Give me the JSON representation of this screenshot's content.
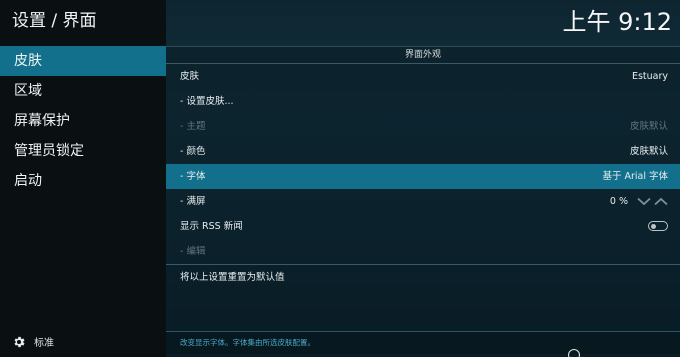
{
  "header": {
    "title": "设置 / 界面",
    "clock": "上午 9:12"
  },
  "sidebar": {
    "items": [
      {
        "label": "皮肤",
        "active": true
      },
      {
        "label": "区域",
        "active": false
      },
      {
        "label": "屏幕保护",
        "active": false
      },
      {
        "label": "管理员锁定",
        "active": false
      },
      {
        "label": "启动",
        "active": false
      }
    ],
    "footer": {
      "icon": "gear-icon",
      "label": "标准"
    }
  },
  "panel": {
    "section_title": "界面外观",
    "rows": [
      {
        "label": "皮肤",
        "value": "Estuary"
      },
      {
        "label": "- 设置皮肤...",
        "value": ""
      },
      {
        "label": "- 主题",
        "value": "皮肤默认"
      },
      {
        "label": "- 颜色",
        "value": "皮肤默认"
      },
      {
        "label": "- 字体",
        "value": "基于 Arial 字体"
      },
      {
        "label": "- 满屏",
        "value": "0 %"
      },
      {
        "label": "显示 RSS 新闻",
        "value": ""
      },
      {
        "label": "- 编辑",
        "value": ""
      }
    ],
    "reset_label": "将以上设置重置为默认值",
    "help_text": "改变显示字体。字体集由所选皮肤配置。"
  },
  "colors": {
    "accent": "#12708c",
    "sidebar_bg": "#0a0f12",
    "disabled_text": "#5f7680",
    "help_text": "#4aa9c9"
  }
}
